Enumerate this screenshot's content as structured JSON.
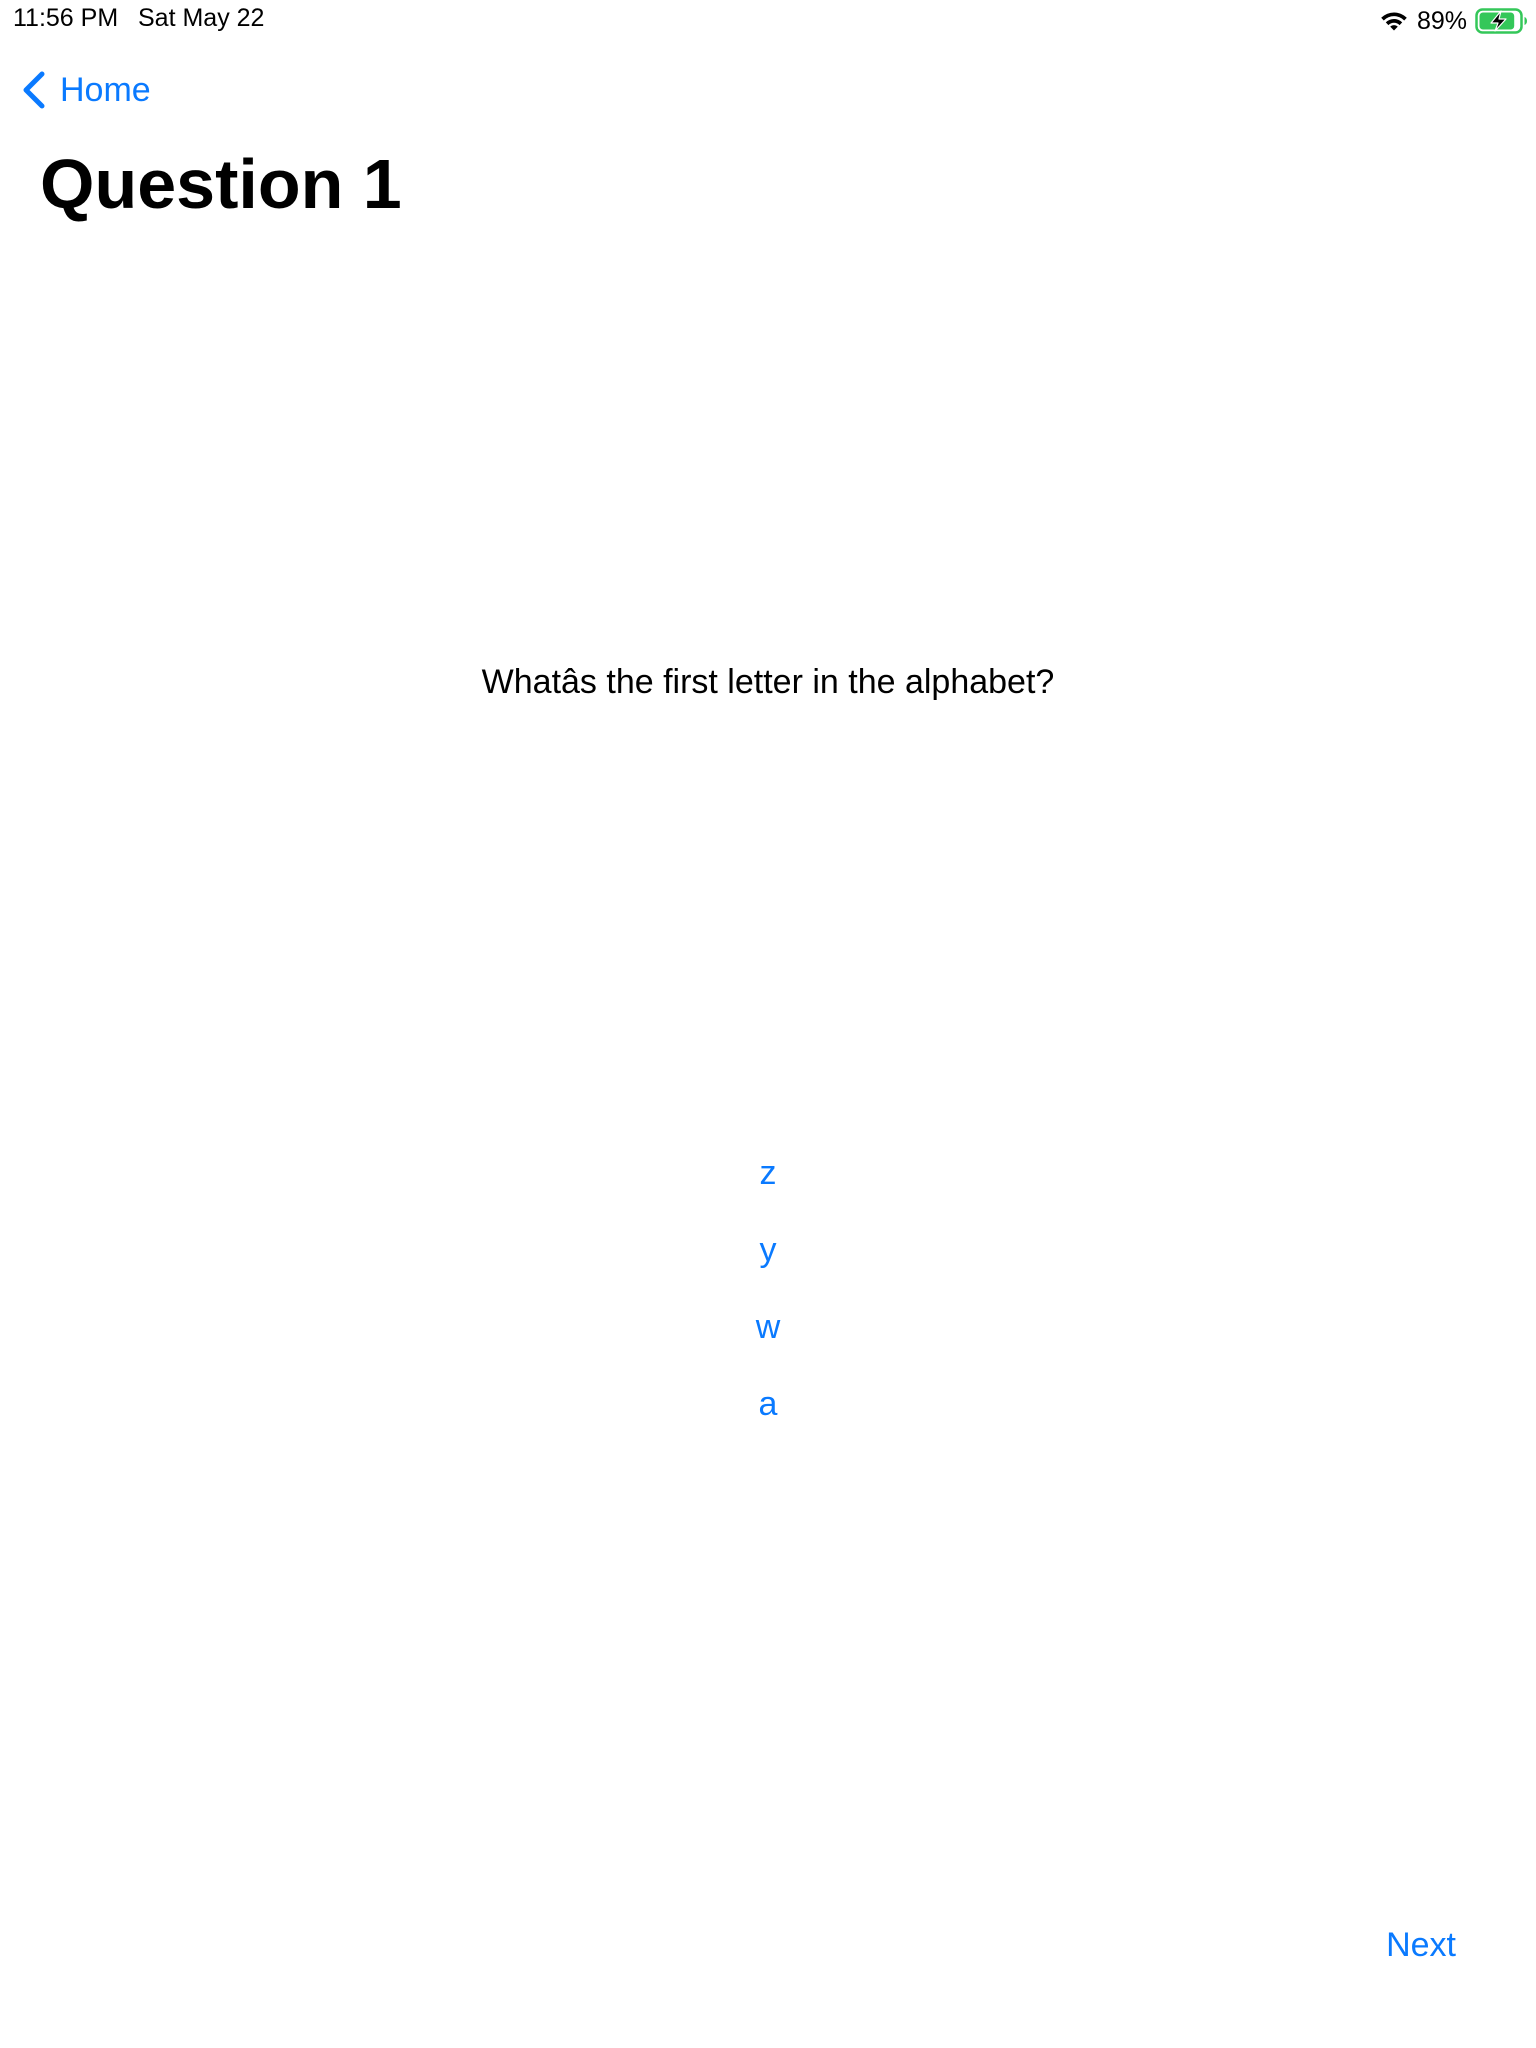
{
  "status_bar": {
    "time": "11:56 PM",
    "date": "Sat May 22",
    "battery_percent": "89%",
    "battery_level": 0.89,
    "charging": true,
    "wifi_icon": "wifi-icon",
    "battery_icon": "battery-charging-icon",
    "battery_color": "#34c759"
  },
  "nav": {
    "back_label": "Home",
    "back_icon": "chevron-left-icon"
  },
  "page": {
    "title": "Question 1"
  },
  "question": {
    "text": "Whatâs the first letter in the alphabet?",
    "options": [
      "z",
      "y",
      "w",
      "a"
    ]
  },
  "footer": {
    "next_label": "Next"
  },
  "colors": {
    "accent": "#0a7aff",
    "text": "#000000",
    "background": "#ffffff"
  }
}
